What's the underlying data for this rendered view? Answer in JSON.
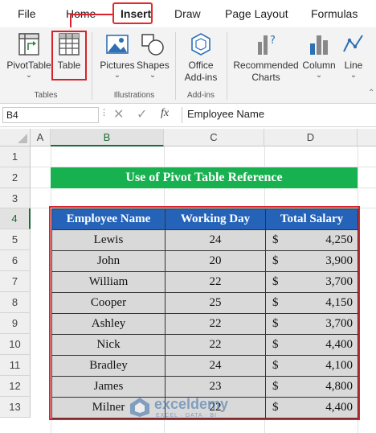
{
  "menu": {
    "items": [
      "File",
      "Home",
      "Insert",
      "Draw",
      "Page Layout",
      "Formulas"
    ],
    "active": "Insert"
  },
  "ribbon": {
    "groups": [
      {
        "label": "Tables",
        "buttons": [
          "PivotTable",
          "Table"
        ]
      },
      {
        "label": "Illustrations",
        "buttons": [
          "Pictures",
          "Shapes"
        ]
      },
      {
        "label": "Add-ins",
        "buttons": [
          "Office Add-ins"
        ]
      },
      {
        "label": "",
        "buttons": [
          "Recommended Charts",
          "Column",
          "Line"
        ]
      }
    ],
    "pivottable": "PivotTable",
    "table": "Table",
    "pictures": "Pictures",
    "shapes": "Shapes",
    "office_line1": "Office",
    "office_line2": "Add-ins",
    "rec_line1": "Recommended",
    "rec_line2": "Charts",
    "column": "Column",
    "line": "Line",
    "group_tables": "Tables",
    "group_illustrations": "Illustrations",
    "group_addins": "Add-ins"
  },
  "formula_bar": {
    "name_box": "B4",
    "fx_label": "fx",
    "content": "Employee Name"
  },
  "sheet": {
    "columns": [
      "A",
      "B",
      "C",
      "D"
    ],
    "rows": [
      "1",
      "2",
      "3",
      "4",
      "5",
      "6",
      "7",
      "8",
      "9",
      "10",
      "11",
      "12",
      "13"
    ],
    "title": "Use of Pivot Table Reference",
    "headers": [
      "Employee Name",
      "Working Day",
      "Total Salary"
    ],
    "currency": "$",
    "data": [
      {
        "name": "Lewis",
        "days": "24",
        "salary": "4,250"
      },
      {
        "name": "John",
        "days": "20",
        "salary": "3,900"
      },
      {
        "name": "William",
        "days": "22",
        "salary": "3,700"
      },
      {
        "name": "Cooper",
        "days": "25",
        "salary": "4,150"
      },
      {
        "name": "Ashley",
        "days": "22",
        "salary": "3,700"
      },
      {
        "name": "Nick",
        "days": "22",
        "salary": "4,400"
      },
      {
        "name": "Bradley",
        "days": "24",
        "salary": "4,100"
      },
      {
        "name": "James",
        "days": "23",
        "salary": "4,800"
      },
      {
        "name": "Milner",
        "days": "22",
        "salary": "4,400"
      }
    ]
  },
  "watermark": {
    "brand": "exceldemy",
    "tagline": "EXCEL · DATA · BI"
  },
  "colors": {
    "title_bg": "#17b14f",
    "header_bg": "#2563b9",
    "cell_bg": "#d9d9d9",
    "highlight": "#d8232a"
  }
}
